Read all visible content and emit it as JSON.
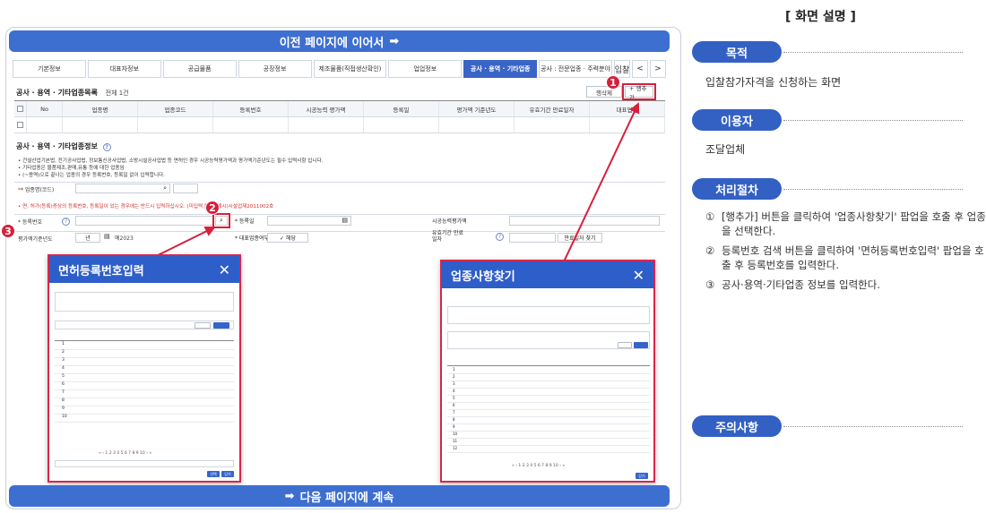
{
  "banner_top": "이전 페이지에 이어서",
  "banner_bottom": "다음 페이지에 계속",
  "arrow": "➡",
  "tabs": [
    "기본정보",
    "대표자정보",
    "공급물품",
    "공장정보",
    "제조물품(직접생산확인)",
    "업업정보",
    "공사 · 용역 · 기타업종",
    "공사 : 전문업종 · 주력분야",
    "입찰",
    "<",
    ">"
  ],
  "list_section": {
    "title": "공사 · 용역 · 기타업종목록",
    "count": "전체 1건",
    "btn_delete": "행삭제",
    "btn_add": "+ 행추가"
  },
  "grid_headers": [
    "No",
    "업종명",
    "업종코드",
    "등록번호",
    "시공능력 평가액",
    "등록일",
    "평가액 기준년도",
    "유효기간 만료일자",
    "대표업종"
  ],
  "info_section": {
    "title": "공사 · 용역 · 기타업종정보",
    "bullets": [
      "• 건설산업기본법, 전기공사업법, 정보통신공사업법, 소방시설공사업법 등 면허인 경우 시공능력평가액과 평가액기준년도는 필수 입력사항 입니다.",
      "• 기타업종은 물품제조,판매,유통 등에 대한 업종임",
      "• (~용역)으로 끝나는 업종의 경우 등록번호, 등록일 없이 입력합니다."
    ],
    "industry_label": "* 업종명(코드)",
    "warning": "• 면, 허가(등록)증상의 등록번호, 등록일이 있는 경우에는 반드시 입력하십시오. (미입력 불가) 예시)시설업제2011002호",
    "reg_no_label": "* 등록번호",
    "reg_date_label": "* 등록일",
    "capacity_label": "시공능력평가액",
    "eval_year_label": "평가액기준년도",
    "eval_year_value": "년",
    "eval_year_ph": "예2023",
    "main_industry_label": "* 대표업종여부",
    "main_industry_value": "해당",
    "expiry_label": "유효기간 만료일자",
    "expiry_btn": "만료일자 찾기"
  },
  "popup_license": {
    "title": "면허등록번호입력",
    "close": "✕",
    "rows": [
      "1",
      "2",
      "3",
      "4",
      "5",
      "6",
      "7",
      "8",
      "9",
      "10"
    ],
    "paging": "« ‹ 1 2 3 4 5 6 7 8 9 10 › »",
    "btn_confirm": "선택",
    "btn_close": "닫기"
  },
  "popup_industry": {
    "title": "업종사항찾기",
    "close": "✕",
    "rows": [
      "1",
      "2",
      "3",
      "4",
      "5",
      "6",
      "7",
      "8",
      "9",
      "10",
      "11",
      "12"
    ],
    "paging": "« ‹ 1 2 3 4 5 6 7 8 9 10 › »",
    "btn_close": "닫기"
  },
  "markers": [
    "1",
    "2",
    "3"
  ],
  "right": {
    "title": "[ 화면 설명 ]",
    "purpose_label": "목적",
    "purpose_text": "입찰참가자격을 신청하는 화면",
    "user_label": "이용자",
    "user_text": "조달업체",
    "process_label": "처리절차",
    "steps": [
      {
        "n": "①",
        "text": "[행추가] 버튼을 클릭하여 '업종사항찾기' 팝업을 호출 후 업종을 선택한다."
      },
      {
        "n": "②",
        "text": "등록번호 검색 버튼을 클릭하여 '면허등록번호입력' 팝업을 호출 후 등록번호를 입력한다."
      },
      {
        "n": "③",
        "text": "공사·용역·기타업종 정보를 입력한다."
      }
    ],
    "caution_label": "주의사항"
  },
  "colors": {
    "accent": "#3360c3",
    "marker": "#d81f3c",
    "banner": "#3d6fd1"
  }
}
